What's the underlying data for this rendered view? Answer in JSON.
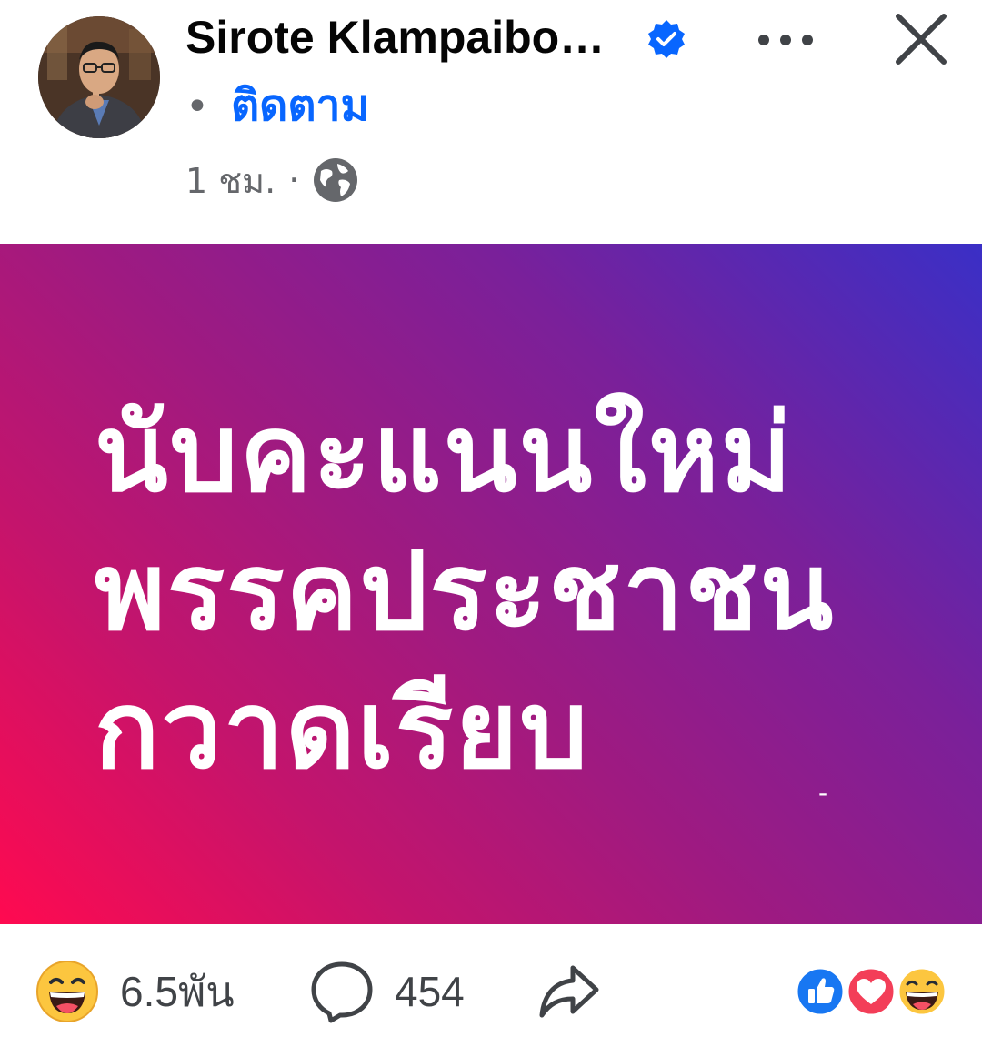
{
  "post": {
    "author": "Sirote Klampaibo…",
    "separator_dot": "•",
    "follow_label": "ติดตาม",
    "time": "1 ชม.",
    "time_separator": "·",
    "privacy_icon": "globe-icon",
    "verified_icon": "verified-badge-icon",
    "image_text": {
      "line1": "นับคะแนนใหม่",
      "line2": "พรรคประชาชน",
      "line3": "กวาดเรียบ",
      "mark": "-"
    }
  },
  "footer": {
    "reaction_icon": "haha-emoji-icon",
    "reaction_count": "6.5พัน",
    "comment_icon": "comment-bubble-icon",
    "comment_count": "454",
    "share_icon": "share-arrow-icon",
    "reaction_summary_icons": [
      "like-icon",
      "love-icon",
      "haha-icon"
    ]
  },
  "colors": {
    "follow_blue": "#0866ff",
    "gradient_start": "#ff0a50",
    "gradient_end": "#3a2fc6",
    "meta_gray": "#65676b"
  }
}
